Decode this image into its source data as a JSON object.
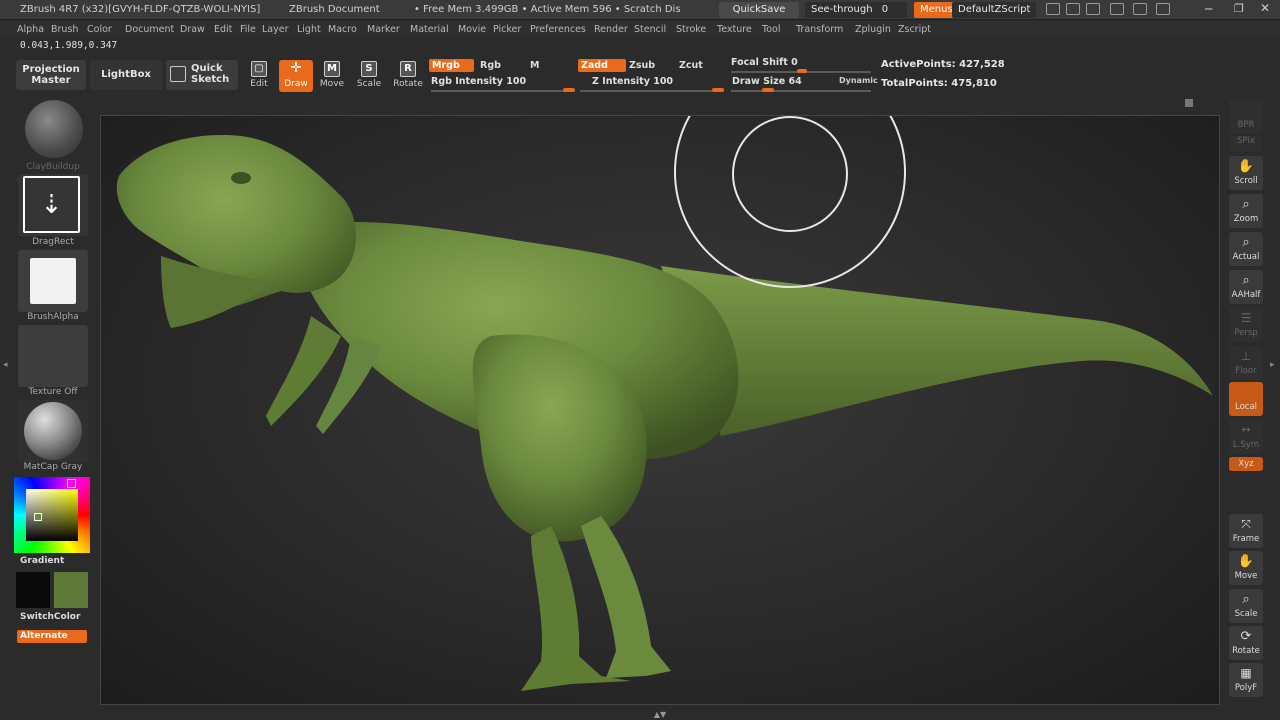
{
  "titlebar": {
    "app": "ZBrush 4R7 (x32)[GVYH-FLDF-QTZB-WOLI-NYIS]",
    "document": "ZBrush Document",
    "memory": "• Free Mem 3.499GB • Active Mem 596 • Scratch Dis",
    "quicksave": "QuickSave",
    "seethrough_label": "See-through",
    "seethrough_value": "0",
    "menus": "Menus",
    "zscript": "DefaultZScript"
  },
  "menu": [
    "Alpha",
    "Brush",
    "Color",
    "Document",
    "Draw",
    "Edit",
    "File",
    "Layer",
    "Light",
    "Macro",
    "Marker",
    "Material",
    "Movie",
    "Picker",
    "Preferences",
    "Render",
    "Stencil",
    "Stroke",
    "Texture",
    "Tool",
    "Transform",
    "Zplugin",
    "Zscript"
  ],
  "coords": "0.043,1.989,0.347",
  "shelf": {
    "projection_master": "Projection Master",
    "lightbox": "LightBox",
    "quick_sketch": "Quick Sketch",
    "tools": [
      {
        "label": "Edit",
        "glyph": "▢"
      },
      {
        "label": "Draw",
        "glyph": "✛"
      },
      {
        "label": "Move",
        "glyph": "M"
      },
      {
        "label": "Scale",
        "glyph": "S"
      },
      {
        "label": "Rotate",
        "glyph": "R"
      }
    ],
    "mrgb": "Mrgb",
    "rgb": "Rgb",
    "m": "M",
    "rgb_intensity_label": "Rgb Intensity",
    "rgb_intensity": "100",
    "zadd": "Zadd",
    "zsub": "Zsub",
    "zcut": "Zcut",
    "z_intensity_label": "Z Intensity",
    "z_intensity": "100",
    "focal_shift_label": "Focal Shift",
    "focal_shift": "0",
    "draw_size_label": "Draw Size",
    "draw_size": "64",
    "dynamic": "Dynamic",
    "active_points_label": "ActivePoints:",
    "active_points": "427,528",
    "total_points_label": "TotalPoints:",
    "total_points": "475,810"
  },
  "left": {
    "brush": "ClayBuildup",
    "stroke": "DragRect",
    "alpha": "BrushAlpha",
    "texture": "Texture Off",
    "material": "MatCap Gray",
    "gradient": "Gradient",
    "switchcolor": "SwitchColor",
    "alternate": "Alternate",
    "main_color": "#5f7a38"
  },
  "right": [
    {
      "label": "BPR",
      "dim": true
    },
    {
      "label": "SPix",
      "dim": true
    },
    {
      "label": "Scroll"
    },
    {
      "label": "Zoom"
    },
    {
      "label": "Actual"
    },
    {
      "label": "AAHalf"
    },
    {
      "label": "Persp",
      "dim": true
    },
    {
      "label": "Floor",
      "dim": true
    },
    {
      "label": "Local",
      "orange": true
    },
    {
      "label": "L.Sym",
      "dim": true
    },
    {
      "label": "Xyz",
      "orange": true
    },
    {
      "label": "Frame"
    },
    {
      "label": "Move"
    },
    {
      "label": "Scale"
    },
    {
      "label": "Rotate"
    },
    {
      "label": "PolyF"
    }
  ],
  "model_color": "#6b8a3d"
}
